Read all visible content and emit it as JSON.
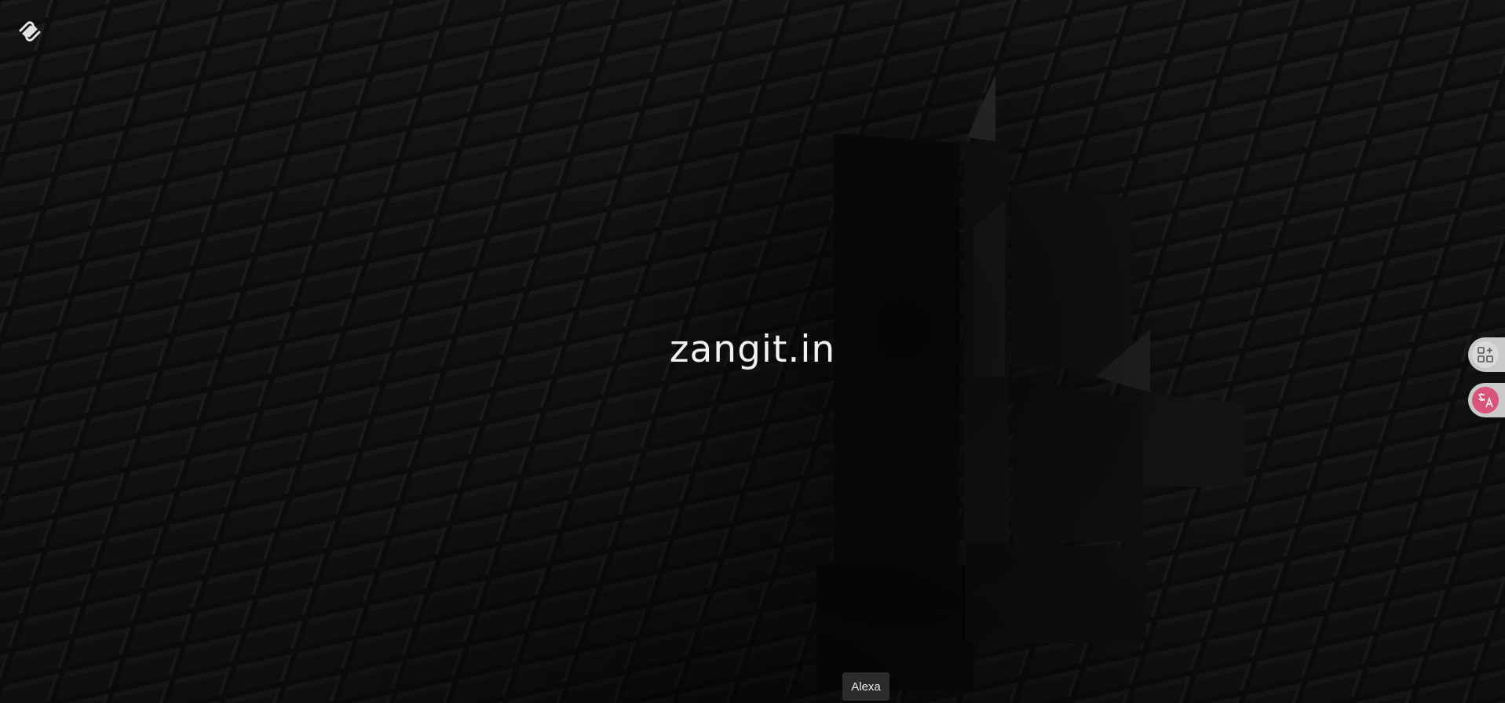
{
  "site": {
    "title": "zangit.in"
  },
  "logo": {
    "icon": "squarespace-logo-icon"
  },
  "side_tools": [
    {
      "name": "apps-add-icon"
    },
    {
      "name": "translate-icon"
    }
  ],
  "footer": {
    "badge_label": "Alexa"
  },
  "colors": {
    "background": "#0a0a0a",
    "title_text": "#f2f2f2",
    "side_button": "#c9c9c9",
    "translate_accent": "#d9547a",
    "badge_bg": "#2b2b2b"
  }
}
